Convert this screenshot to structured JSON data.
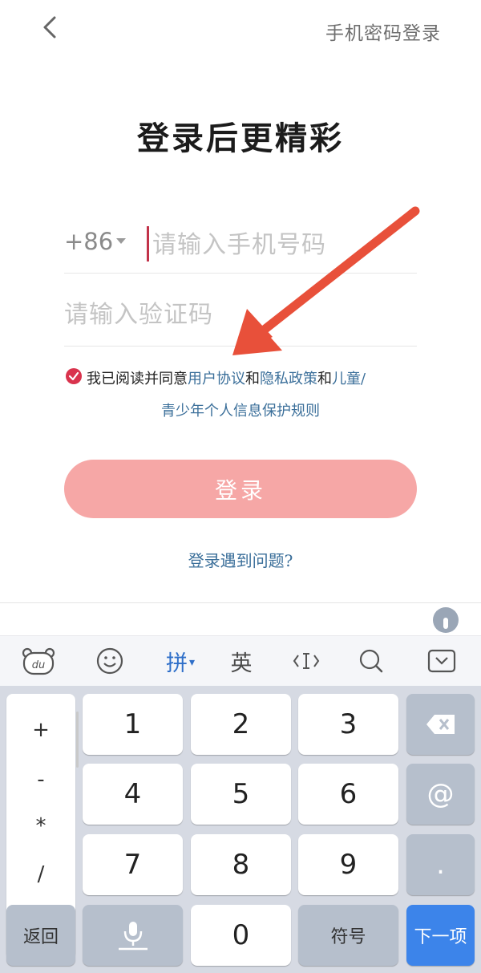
{
  "header": {
    "back_icon": "chevron-left-icon",
    "password_login": "手机密码登录"
  },
  "title": "登录后更精彩",
  "phone": {
    "country_code": "+86",
    "placeholder": "请输入手机号码"
  },
  "code": {
    "placeholder": "请输入验证码"
  },
  "agreement": {
    "checked": true,
    "prefix": "我已阅读并同意",
    "user_agreement": "用户协议",
    "and1": "和",
    "privacy_policy": "隐私政策",
    "and2": "和",
    "children_part1": "儿童/",
    "children_part2": "青少年个人信息保护规则"
  },
  "login_button": "登录",
  "login_problem": "登录遇到问题?",
  "colors": {
    "accent": "#d9334d",
    "login_button": "#f6a7a6",
    "link": "#3b6f9a",
    "arrow": "#e8503a",
    "keyboard_next": "#3c84ea"
  },
  "keyboard": {
    "toolbar": {
      "baidu_icon": "du-bear-icon",
      "emoji_icon": "smiley-icon",
      "pinyin": "拼",
      "english": "英",
      "cursor_icon": "text-cursor-icon",
      "search_icon": "search-icon",
      "collapse_icon": "keyboard-collapse-icon"
    },
    "symbols": [
      "+",
      "-",
      "*",
      "/"
    ],
    "digits": [
      "1",
      "2",
      "3",
      "4",
      "5",
      "6",
      "7",
      "8",
      "9",
      "0"
    ],
    "at": "@",
    "dot": ".",
    "back": "返回",
    "symbol_key": "符号",
    "next": "下一项"
  }
}
